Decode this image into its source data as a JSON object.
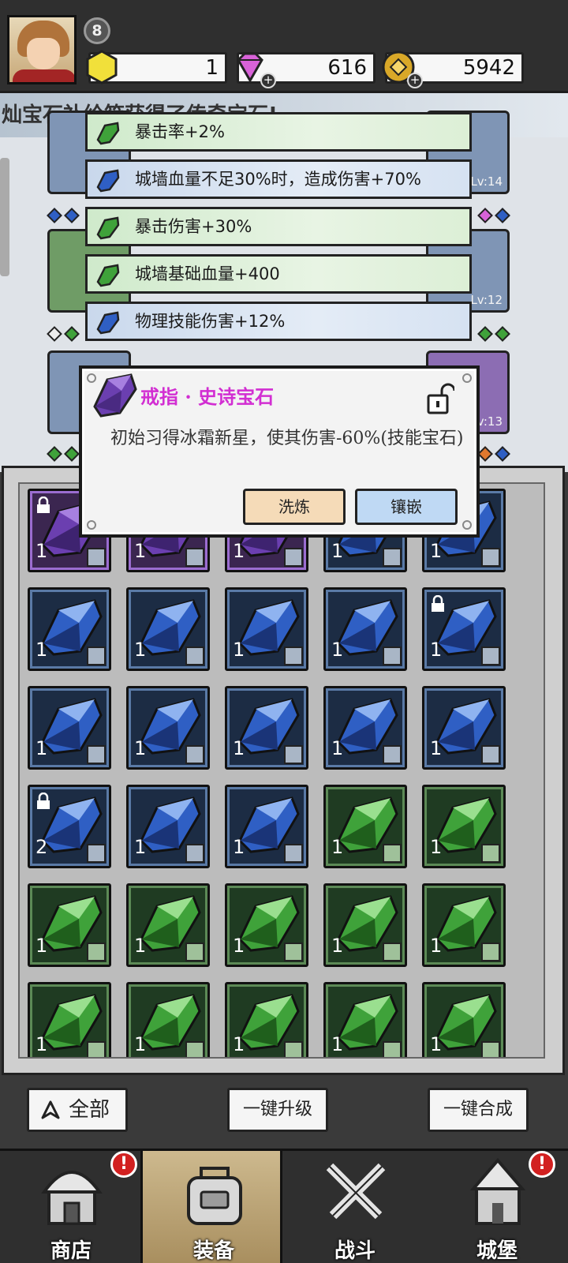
{
  "header": {
    "level": "8",
    "resources": [
      {
        "name": "gem-yellow",
        "value": "1"
      },
      {
        "name": "diamond",
        "value": "616"
      },
      {
        "name": "gold-coin",
        "value": "5942"
      }
    ]
  },
  "banner_text": "灿宝石补给箱获得了传奇宝石!",
  "equipment_levels": {
    "top_right": "Lv:14",
    "mid_right": "Lv:12",
    "low_right": "Lv:13"
  },
  "stats": [
    {
      "label": "暴击率+2%",
      "color": "green"
    },
    {
      "label": "城墙血量不足30%时，造成伤害+70%",
      "color": "blue"
    },
    {
      "label": "暴击伤害+30%",
      "color": "green"
    },
    {
      "label": "城墙基础血量+400",
      "color": "green"
    },
    {
      "label": "物理技能伤害+12%",
      "color": "blue"
    }
  ],
  "popup": {
    "title": "戒指 · 史诗宝石",
    "description": "初始习得冰霜新星，使其伤害-60%(技能宝石)",
    "refine_label": "洗炼",
    "inlay_label": "镶嵌",
    "lock_state": "unlocked"
  },
  "inventory": {
    "rows": [
      [
        {
          "color": "purple",
          "count": "1",
          "slot": "ring",
          "locked": true
        },
        {
          "color": "purple",
          "count": "1",
          "slot": "helmet",
          "locked": false
        },
        {
          "color": "purple",
          "count": "1",
          "slot": "helmet",
          "locked": false
        },
        {
          "color": "blue",
          "count": "1",
          "slot": "ring",
          "locked": false
        },
        {
          "color": "blue",
          "count": "1",
          "slot": "ring",
          "locked": false
        }
      ],
      [
        {
          "color": "blue",
          "count": "1",
          "slot": "armor",
          "locked": false
        },
        {
          "color": "blue",
          "count": "1",
          "slot": "armor",
          "locked": false
        },
        {
          "color": "blue",
          "count": "1",
          "slot": "boots",
          "locked": false
        },
        {
          "color": "blue",
          "count": "1",
          "slot": "boots",
          "locked": false
        },
        {
          "color": "blue",
          "count": "1",
          "slot": "boots",
          "locked": true
        }
      ],
      [
        {
          "color": "blue",
          "count": "1",
          "slot": "boots",
          "locked": false
        },
        {
          "color": "blue",
          "count": "1",
          "slot": "weapon",
          "locked": false
        },
        {
          "color": "blue",
          "count": "1",
          "slot": "weapon",
          "locked": false
        },
        {
          "color": "blue",
          "count": "1",
          "slot": "helmet",
          "locked": false
        },
        {
          "color": "blue",
          "count": "1",
          "slot": "necklace",
          "locked": false
        }
      ],
      [
        {
          "color": "blue",
          "count": "2",
          "slot": "necklace",
          "locked": true
        },
        {
          "color": "blue",
          "count": "1",
          "slot": "necklace",
          "locked": false
        },
        {
          "color": "blue",
          "count": "1",
          "slot": "necklace",
          "locked": false
        },
        {
          "color": "green",
          "count": "1",
          "slot": "armor",
          "locked": false
        },
        {
          "color": "green",
          "count": "1",
          "slot": "armor",
          "locked": false
        }
      ],
      [
        {
          "color": "green",
          "count": "1",
          "slot": "boots",
          "locked": false
        },
        {
          "color": "green",
          "count": "1",
          "slot": "boots",
          "locked": false
        },
        {
          "color": "green",
          "count": "1",
          "slot": "boots",
          "locked": false
        },
        {
          "color": "green",
          "count": "1",
          "slot": "boots",
          "locked": false
        },
        {
          "color": "green",
          "count": "1",
          "slot": "weapon",
          "locked": false
        }
      ],
      [
        {
          "color": "green",
          "count": "1",
          "slot": "weapon",
          "locked": false
        },
        {
          "color": "green",
          "count": "1",
          "slot": "weapon",
          "locked": false
        },
        {
          "color": "green",
          "count": "1",
          "slot": "weapon",
          "locked": false
        },
        {
          "color": "green",
          "count": "1",
          "slot": "helmet",
          "locked": false
        },
        {
          "color": "green",
          "count": "1",
          "slot": "helmet",
          "locked": false
        }
      ]
    ]
  },
  "controls": {
    "filter_label": "全部",
    "upgrade_label": "一键升级",
    "merge_label": "一键合成"
  },
  "nav": [
    {
      "label": "商店",
      "alert": true,
      "active": false
    },
    {
      "label": "装备",
      "alert": false,
      "active": true
    },
    {
      "label": "战斗",
      "alert": false,
      "active": false
    },
    {
      "label": "城堡",
      "alert": true,
      "active": false
    }
  ],
  "colors": {
    "epic": "#d22ed2",
    "gem_green": "#3fa23a",
    "gem_blue": "#2f5fc4",
    "gem_purple": "#6b3fb0",
    "alert": "#d22020"
  }
}
